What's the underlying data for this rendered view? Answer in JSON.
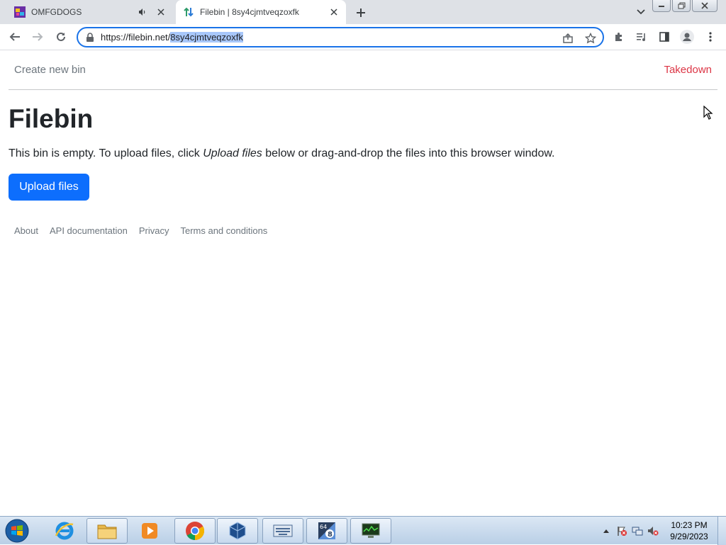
{
  "browser": {
    "tabs": [
      {
        "title": "OMFGDOGS",
        "favicon": "omfgdogs-favicon",
        "audio": "speaker-icon",
        "active": false
      },
      {
        "title": "Filebin | 8sy4cjmtveqzoxfk",
        "favicon": "filebin-favicon",
        "active": true
      }
    ],
    "url_prefix": "https://filebin.net/",
    "url_selected": "8sy4cjmtveqzoxfk"
  },
  "page": {
    "nav": {
      "create": "Create new bin",
      "takedown": "Takedown"
    },
    "title": "Filebin",
    "lead_before": "This bin is empty. To upload files, click ",
    "lead_em": "Upload files",
    "lead_after": " below or drag-and-drop the files into this browser window.",
    "upload_button": "Upload files",
    "footer": [
      "About",
      "API documentation",
      "Privacy",
      "Terms and conditions"
    ]
  },
  "taskbar": {
    "clock_time": "10:23 PM",
    "clock_date": "9/29/2023"
  },
  "colors": {
    "primary": "#0d6efd",
    "danger": "#dc3545",
    "muted": "#6c757d",
    "omnibox_focus": "#1a73e8"
  }
}
